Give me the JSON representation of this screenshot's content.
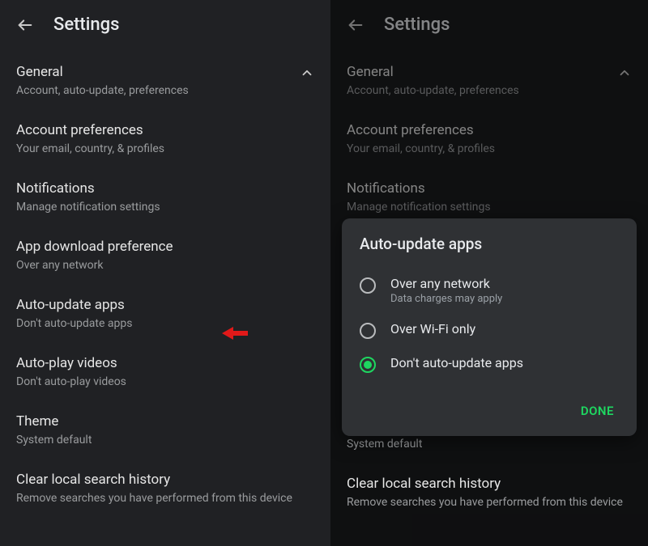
{
  "left": {
    "header": {
      "title": "Settings"
    },
    "sections": [
      {
        "title": "General",
        "sub": "Account, auto-update, preferences"
      },
      {
        "title": "Account preferences",
        "sub": "Your email, country, & profiles"
      },
      {
        "title": "Notifications",
        "sub": "Manage notification settings"
      },
      {
        "title": "App download preference",
        "sub": "Over any network"
      },
      {
        "title": "Auto-update apps",
        "sub": "Don't auto-update apps"
      },
      {
        "title": "Auto-play videos",
        "sub": "Don't auto-play videos"
      },
      {
        "title": "Theme",
        "sub": "System default"
      },
      {
        "title": "Clear local search history",
        "sub": "Remove searches you have performed from this device"
      }
    ]
  },
  "right": {
    "header": {
      "title": "Settings"
    },
    "sections": [
      {
        "title": "General",
        "sub": "Account, auto-update, preferences"
      },
      {
        "title": "Account preferences",
        "sub": "Your email, country, & profiles"
      },
      {
        "title": "Notifications",
        "sub": "Manage notification settings"
      }
    ],
    "below": [
      {
        "title": "System default",
        "sub": ""
      },
      {
        "title": "Clear local search history",
        "sub": "Remove searches you have performed from this device"
      }
    ],
    "dialog": {
      "title": "Auto-update apps",
      "options": [
        {
          "label": "Over any network",
          "sub": "Data charges may apply",
          "selected": false
        },
        {
          "label": "Over Wi-Fi only",
          "sub": "",
          "selected": false
        },
        {
          "label": "Don't auto-update apps",
          "sub": "",
          "selected": true
        }
      ],
      "done": "DONE"
    }
  },
  "colors": {
    "accent": "#1ed760",
    "arrow": "#e11919"
  }
}
